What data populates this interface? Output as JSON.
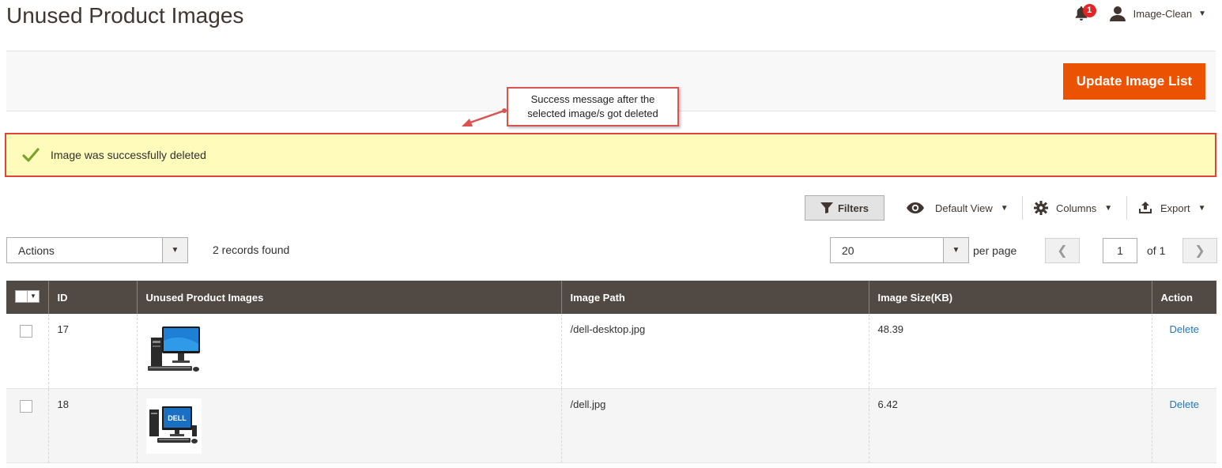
{
  "header": {
    "title": "Unused Product Images",
    "notification_count": "1",
    "user_name": "Image-Clean"
  },
  "toolbar": {
    "update_label": "Update Image List"
  },
  "callout": {
    "line1": "Success message after the",
    "line2": "selected image/s got deleted"
  },
  "message": {
    "text": "Image was successfully deleted"
  },
  "grid_controls": {
    "filters_label": "Filters",
    "view_label": "Default View",
    "columns_label": "Columns",
    "export_label": "Export"
  },
  "grid_toolbar": {
    "actions_value": "Actions",
    "records_text": "2 records found",
    "page_size": "20",
    "per_page_label": "per page",
    "current_page": "1",
    "of_pages": "of 1"
  },
  "table": {
    "columns": [
      "ID",
      "Unused Product Images",
      "Image Path",
      "Image Size(KB)",
      "Action"
    ],
    "rows": [
      {
        "id": "17",
        "image": "desktop-monitor-image",
        "path": "/dell-desktop.jpg",
        "size": "48.39",
        "action": "Delete"
      },
      {
        "id": "18",
        "image": "dell-desktop-image",
        "path": "/dell.jpg",
        "size": "6.42",
        "action": "Delete"
      }
    ]
  },
  "colors": {
    "accent": "#eb5202",
    "header_bg": "#514943",
    "message_bg": "#fffbbb",
    "highlight_border": "#e0453c",
    "link": "#1979c3"
  }
}
